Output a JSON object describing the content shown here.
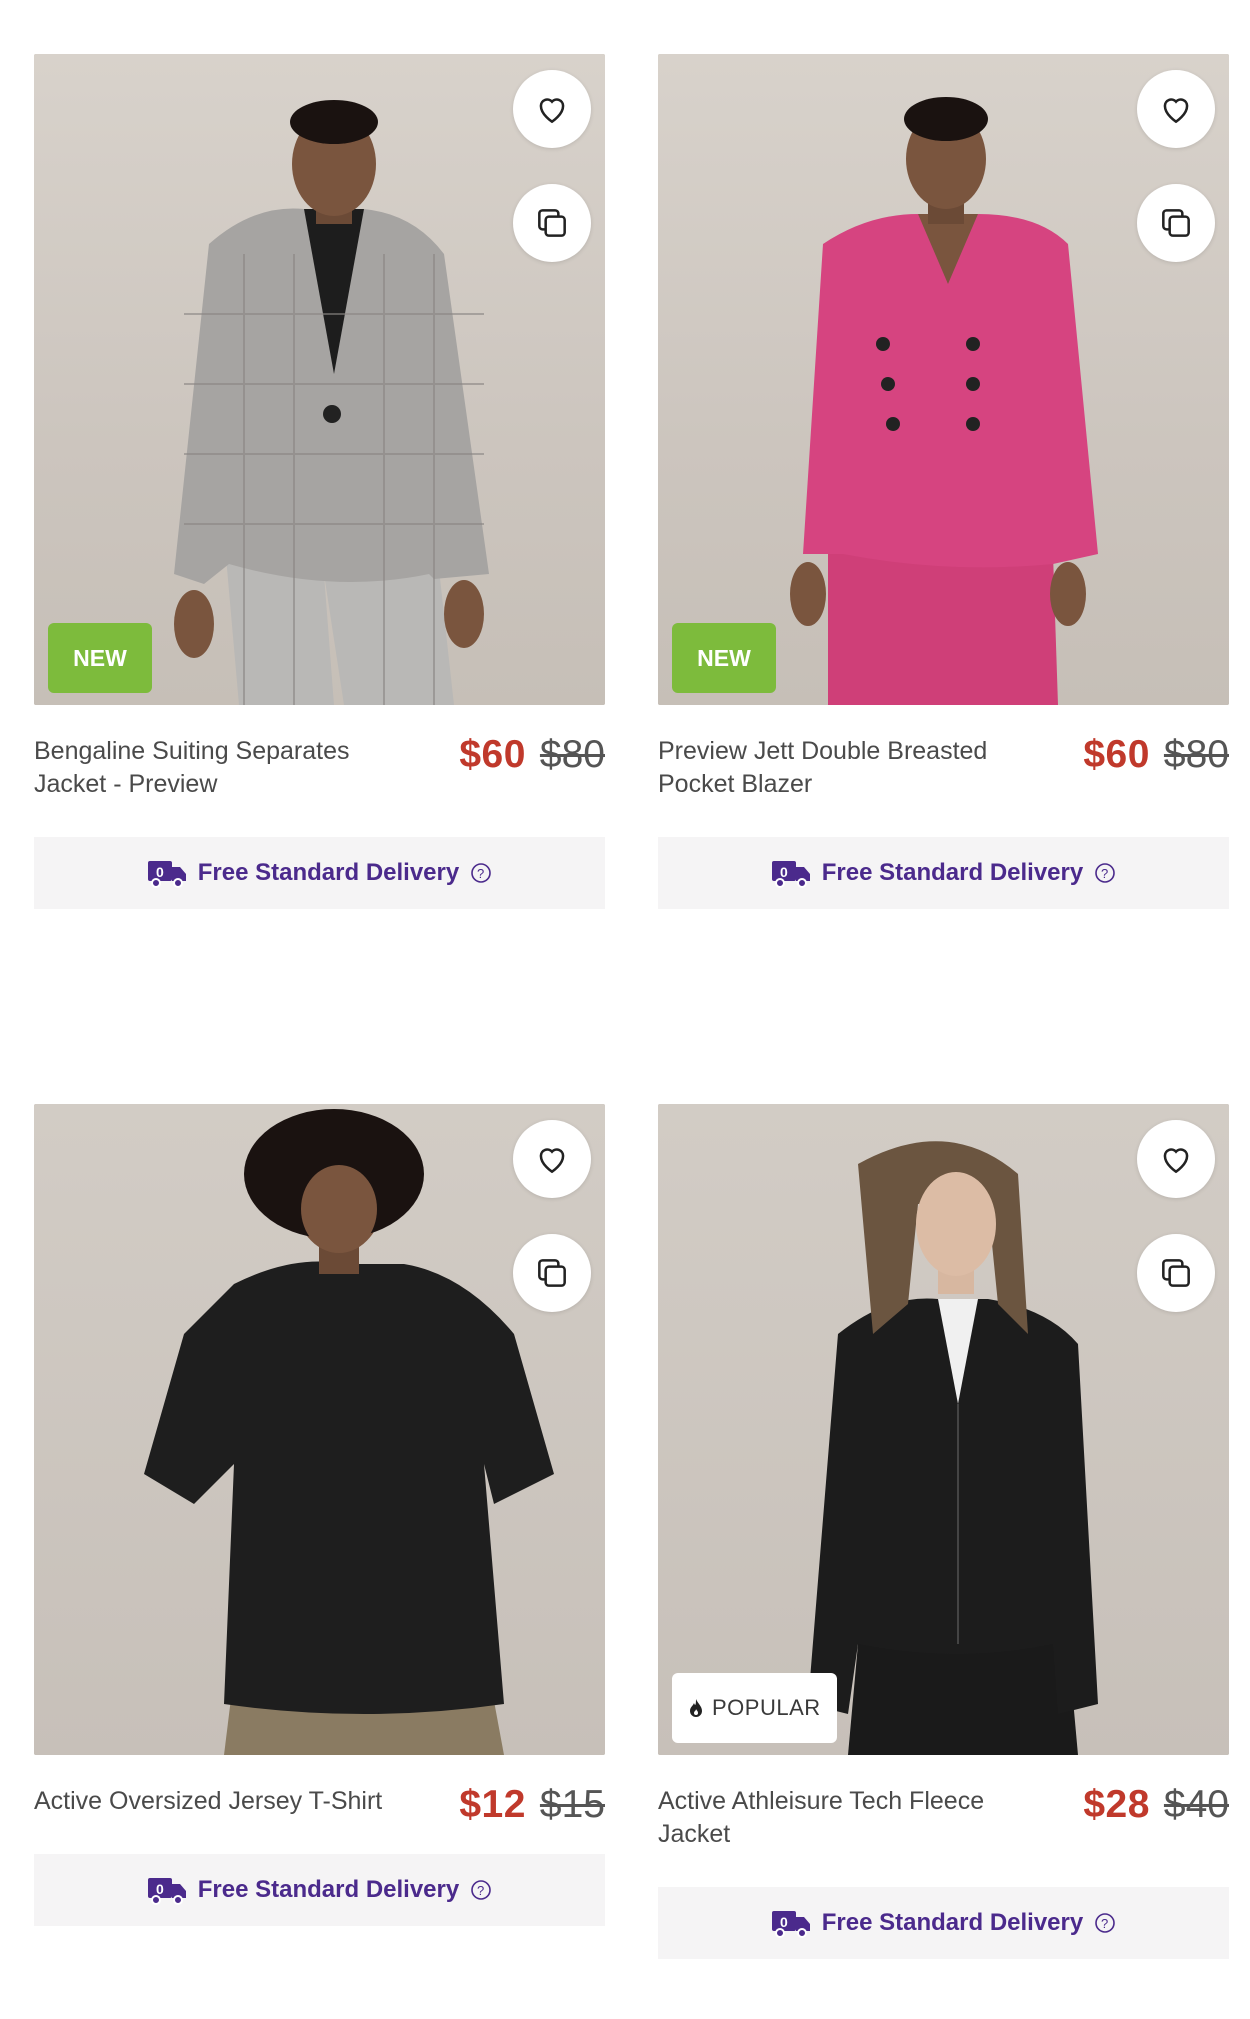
{
  "products": [
    {
      "title": "Bengaline Suiting Separates Jacket - Preview",
      "price_now": "$60",
      "price_was": "$80",
      "badge": "NEW",
      "delivery": "Free Standard Delivery"
    },
    {
      "title": "Preview Jett Double Breasted Pocket Blazer",
      "price_now": "$60",
      "price_was": "$80",
      "badge": "NEW",
      "delivery": "Free Standard Delivery"
    },
    {
      "title": "Active Oversized Jersey T-Shirt",
      "price_now": "$12",
      "price_was": "$15",
      "delivery": "Free Standard Delivery"
    },
    {
      "title": "Active Athleisure Tech Fleece Jacket",
      "price_now": "$28",
      "price_was": "$40",
      "badge": "POPULAR",
      "delivery": "Free Standard Delivery"
    }
  ],
  "colors": {
    "sale_price": "#c0392b",
    "delivery_text": "#4b2a8c",
    "badge_new": "#7dbb3c"
  }
}
